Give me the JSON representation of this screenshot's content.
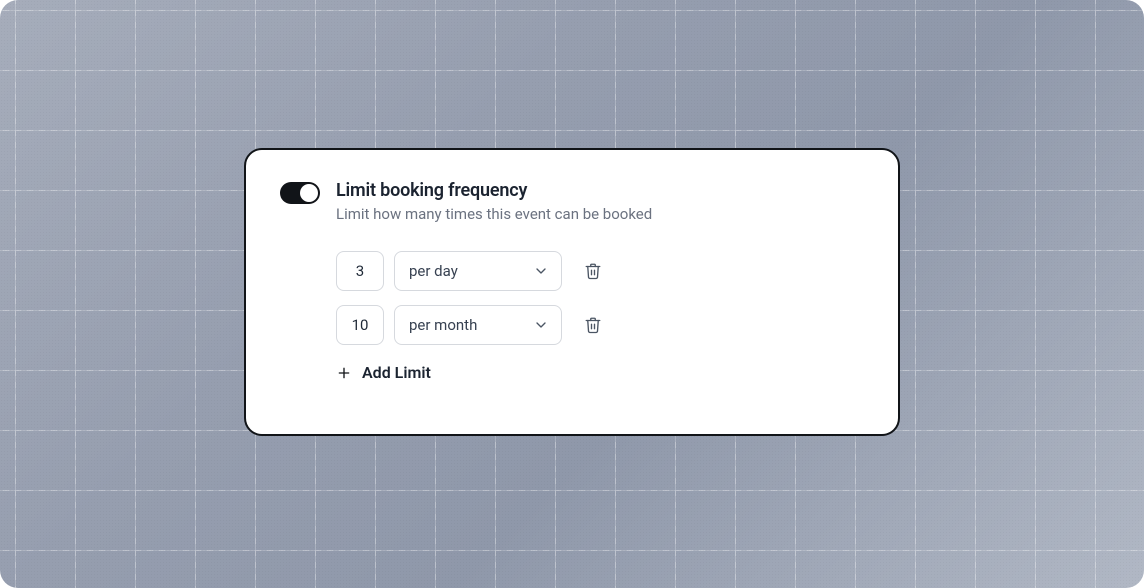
{
  "card": {
    "toggle_on": true,
    "title": "Limit booking frequency",
    "subtitle": "Limit how many times this event can be booked",
    "limits": [
      {
        "count": "3",
        "period": "per day"
      },
      {
        "count": "10",
        "period": "per month"
      }
    ],
    "add_label": "Add Limit"
  }
}
